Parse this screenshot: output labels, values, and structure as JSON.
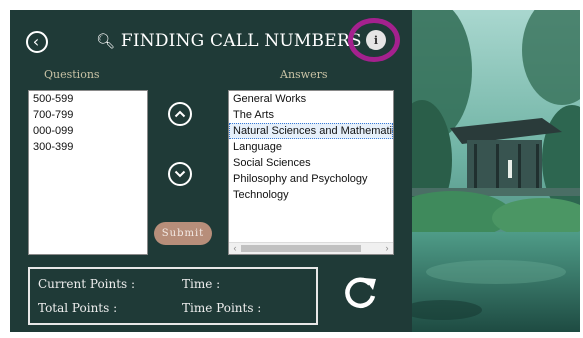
{
  "header": {
    "title": "FINDING CALL NUMBERS",
    "search_glyph_left": "⚲",
    "search_glyph_right": "⚲",
    "back_icon": "chevron-left-icon",
    "info_label": "i"
  },
  "questions": {
    "label": "Questions",
    "items": [
      "500-599",
      "700-799",
      "000-099",
      "300-399"
    ]
  },
  "answers": {
    "label": "Answers",
    "items": [
      "General Works",
      "The Arts",
      "Natural Sciences and Mathematics",
      "Language",
      "Social Sciences",
      "Philosophy and Psychology",
      "Technology"
    ],
    "selected_index": 2
  },
  "controls": {
    "up_icon": "chevron-up-icon",
    "down_icon": "chevron-down-icon",
    "submit_label": "Submit",
    "refresh_icon": "refresh-icon"
  },
  "stats": {
    "current_points_label": "Current Points :",
    "total_points_label": "Total Points :",
    "time_label": "Time  :",
    "time_points_label": "Time Points :"
  },
  "colors": {
    "background": "#1f3a37",
    "annotation_ring": "#a4218e",
    "submit_button": "#b78e7a",
    "label_text": "#c8c2a5"
  }
}
